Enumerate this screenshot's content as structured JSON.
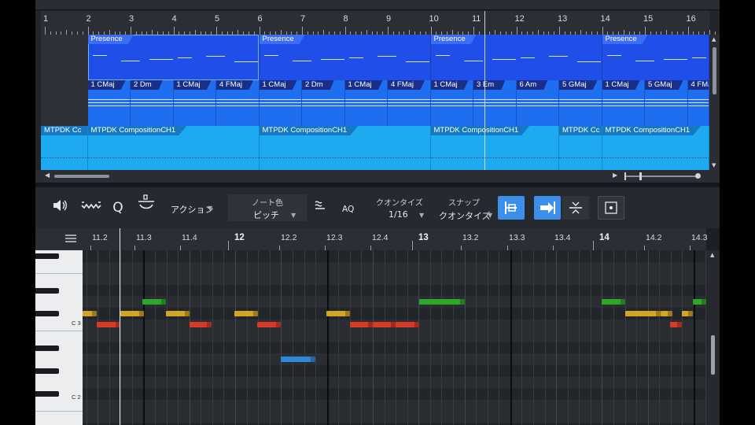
{
  "arrange": {
    "ruler_bars": [
      "1",
      "2",
      "3",
      "4",
      "5",
      "6",
      "7",
      "8",
      "9",
      "10",
      "11",
      "12",
      "13",
      "14",
      "15",
      "16"
    ],
    "presence_clips": [
      {
        "label": "Presence"
      },
      {
        "label": "Presence"
      },
      {
        "label": "Presence"
      },
      {
        "label": "Presence"
      }
    ],
    "chord_clips": [
      {
        "label": "1 CMaj"
      },
      {
        "label": "2 Dm"
      },
      {
        "label": "1 CMaj"
      },
      {
        "label": "4 FMaj"
      },
      {
        "label": "1 CMaj"
      },
      {
        "label": "2 Dm"
      },
      {
        "label": "1 CMaj"
      },
      {
        "label": "4 FMaj"
      },
      {
        "label": "1 CMaj"
      },
      {
        "label": "3 Em"
      },
      {
        "label": "6 Am"
      },
      {
        "label": "5 GMaj"
      },
      {
        "label": "1 CMaj"
      },
      {
        "label": "5 GMaj"
      },
      {
        "label": "4 FMa"
      }
    ],
    "comp_clips": [
      {
        "label": "MTPDK Cc"
      },
      {
        "label": "MTPDK CompositionCH1"
      },
      {
        "label": "MTPDK CompositionCH1"
      },
      {
        "label": "MTPDK CompositionCH1"
      },
      {
        "label": "MTPDK Cc"
      },
      {
        "label": "MTPDK CompositionCH1"
      }
    ]
  },
  "toolbar": {
    "action_label": "アクション",
    "note_color_label": "ノート色",
    "note_color_value": "ピッチ",
    "aq_label": "AQ",
    "quantize_label": "クオンタイズ",
    "quantize_value": "1/16",
    "snap_label": "スナップ",
    "snap_value": "クオンタイズ",
    "icons": [
      "speaker-icon",
      "tilde-icon",
      "q-icon",
      "scissors-icon",
      "humanize-icon",
      "select-snap-icon",
      "forward-snap-icon",
      "grid-snap-icon",
      "zoom-fit-icon",
      "expand-icon",
      "close-icon"
    ]
  },
  "editor": {
    "ruler_labels": [
      "11.2",
      "11.3",
      "11.4",
      "12",
      "12.2",
      "12.3",
      "12.4",
      "13",
      "13.2",
      "13.3",
      "13.4",
      "14",
      "14.2",
      "14.3"
    ],
    "key_labels": [
      "C 3",
      "C 2"
    ],
    "note_colors": {
      "green": "#2fa82a",
      "yellow": "#d2a524",
      "red": "#d83a27",
      "blue": "#2f88d6"
    }
  }
}
